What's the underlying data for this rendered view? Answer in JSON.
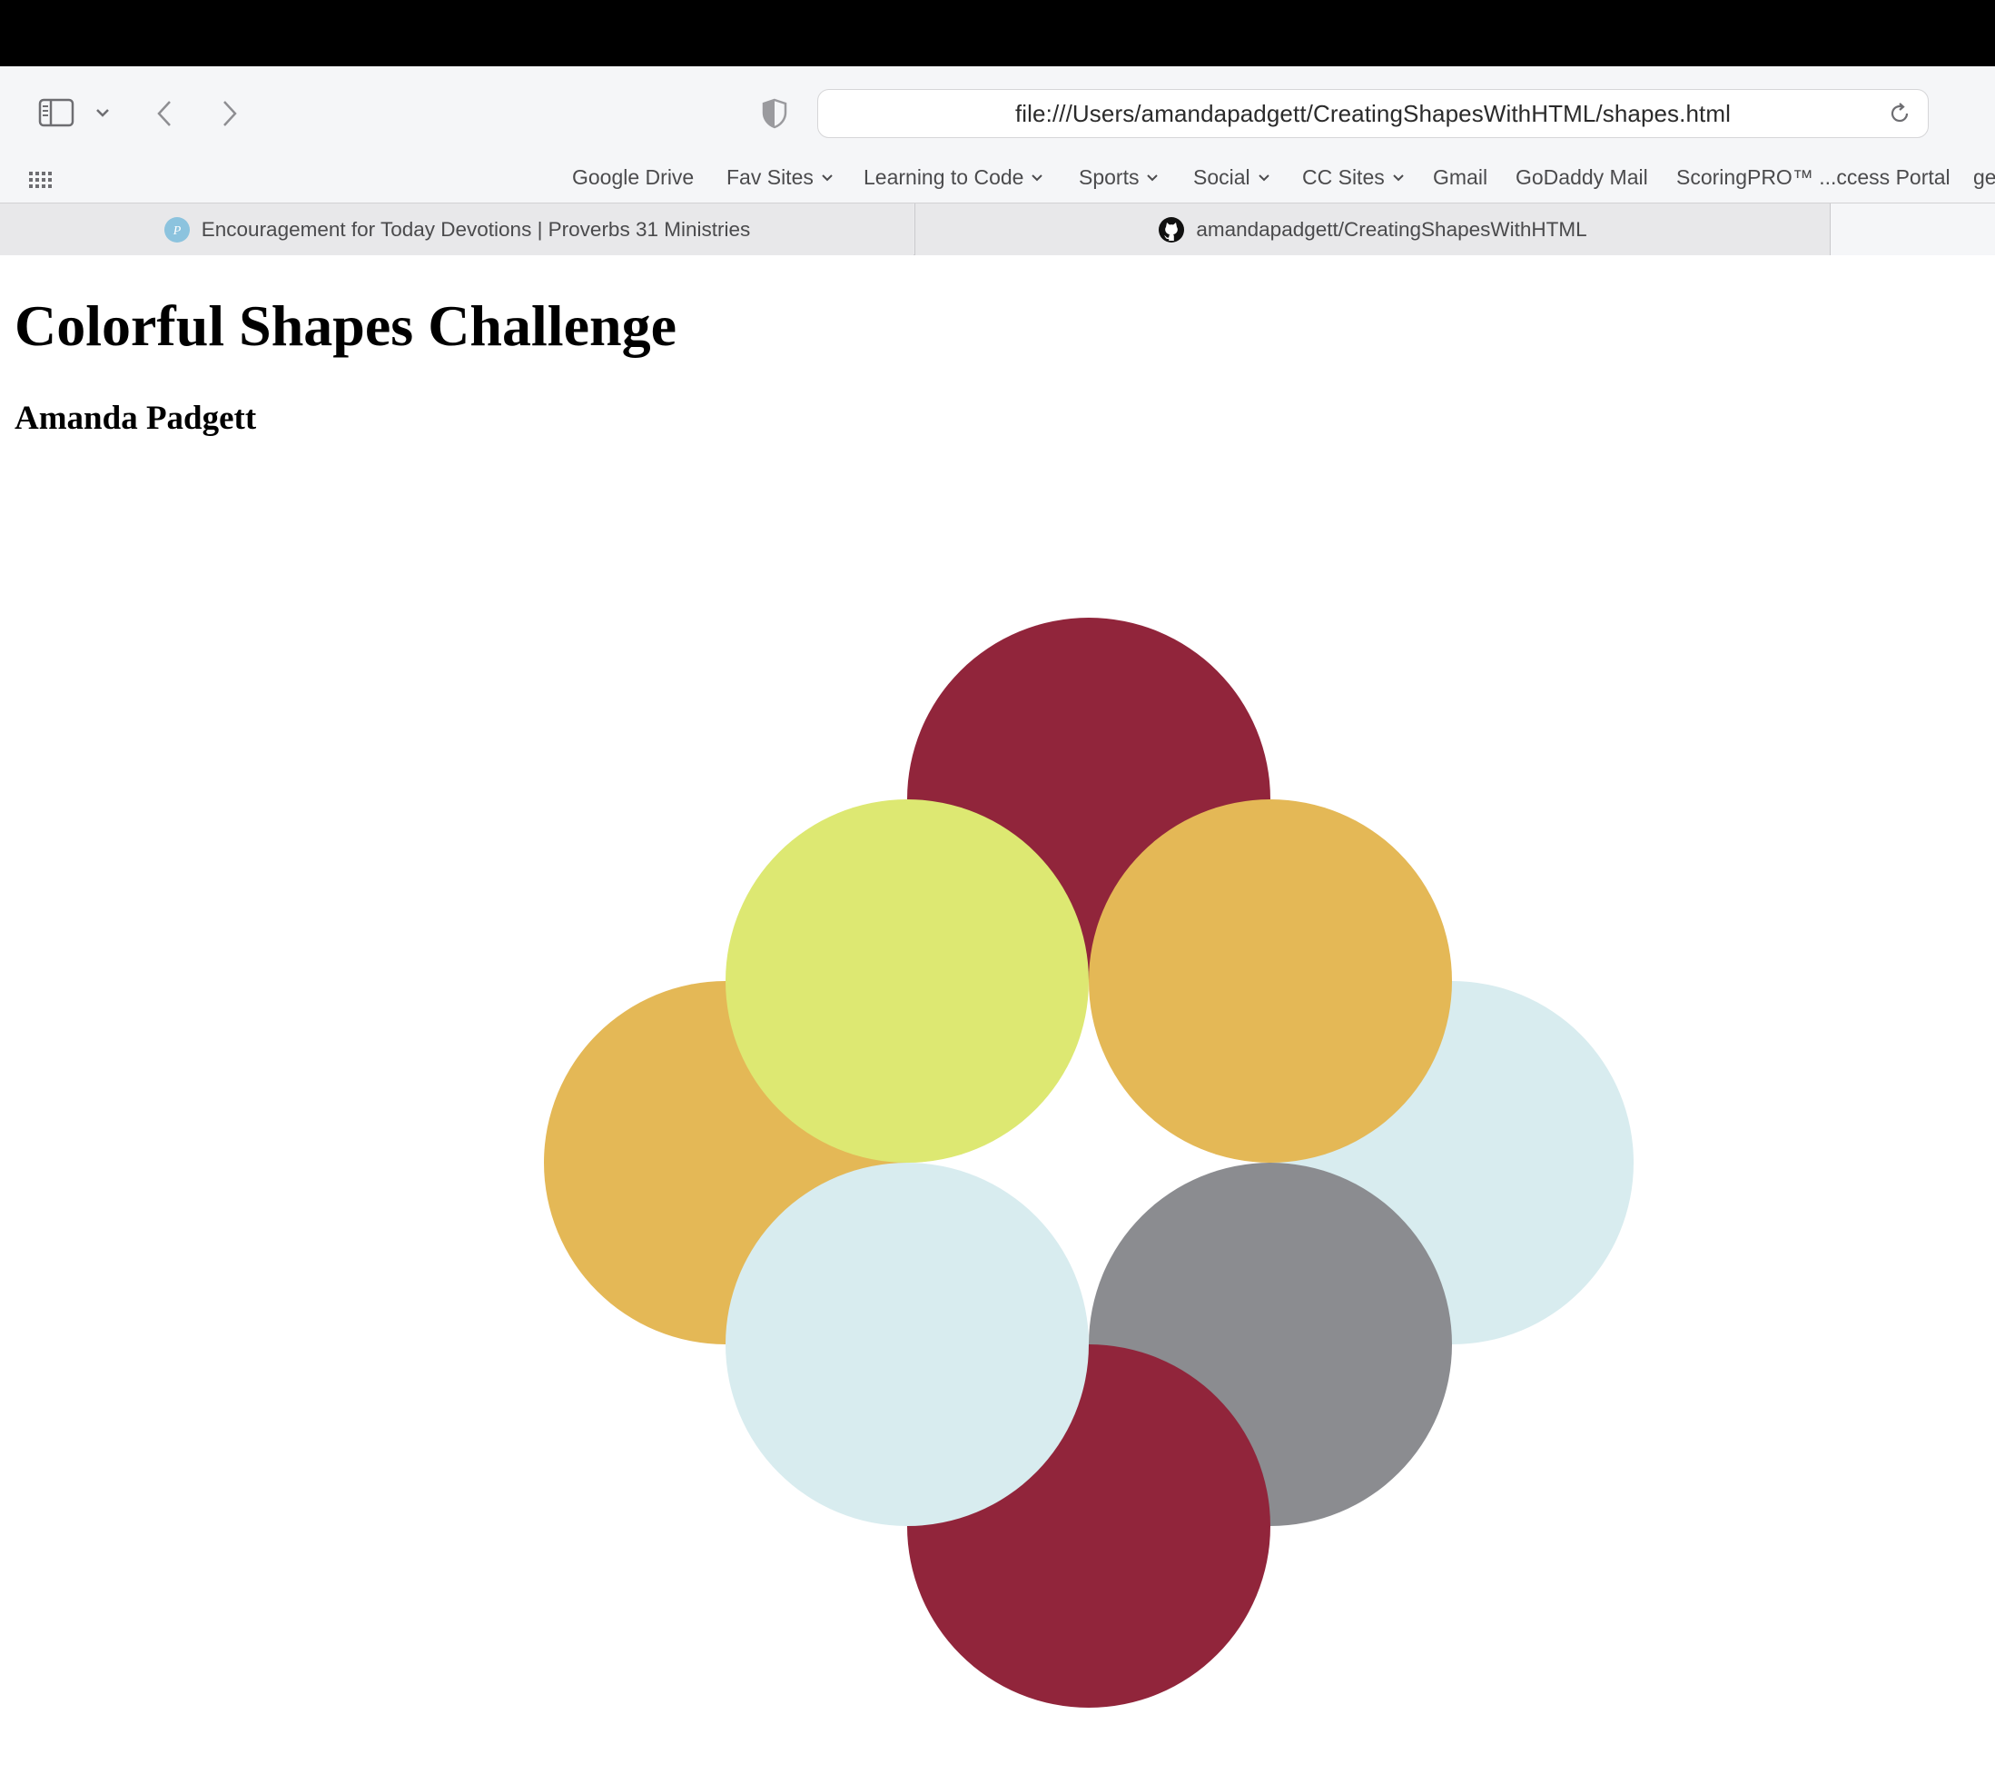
{
  "browser": {
    "url": "file:///Users/amandapadgett/CreatingShapesWithHTML/shapes.html",
    "favorites": [
      {
        "label": "Google Drive",
        "dropdown": false
      },
      {
        "label": "Fav Sites",
        "dropdown": true
      },
      {
        "label": "Learning to Code",
        "dropdown": true
      },
      {
        "label": "Sports",
        "dropdown": true
      },
      {
        "label": "Social",
        "dropdown": true
      },
      {
        "label": "CC Sites",
        "dropdown": true
      },
      {
        "label": "Gmail",
        "dropdown": false
      },
      {
        "label": "GoDaddy Mail",
        "dropdown": false
      },
      {
        "label": "ScoringPRO™ ...ccess Portal",
        "dropdown": false
      },
      {
        "label": "ge",
        "dropdown": false
      }
    ],
    "tabs": [
      {
        "title": "Encouragement for Today Devotions | Proverbs 31 Ministries",
        "icon": "proverbs31-favicon-icon"
      },
      {
        "title": "amandapadgett/CreatingShapesWithHTML",
        "icon": "github-icon"
      }
    ]
  },
  "page": {
    "title": "Colorful Shapes Challenge",
    "author": "Amanda Padgett"
  },
  "shapes": {
    "circles": [
      {
        "name": "circle-top",
        "color": "#91253b"
      },
      {
        "name": "circle-left",
        "color": "#e4b856"
      },
      {
        "name": "circle-right",
        "color": "#d8ecef"
      },
      {
        "name": "circle-bottom-right",
        "color": "#8b8c90"
      },
      {
        "name": "circle-bottom",
        "color": "#91253b"
      },
      {
        "name": "circle-bottom-left",
        "color": "#d8ecef"
      },
      {
        "name": "circle-top-left",
        "color": "#dde872"
      },
      {
        "name": "circle-top-right",
        "color": "#e4b856"
      }
    ]
  }
}
